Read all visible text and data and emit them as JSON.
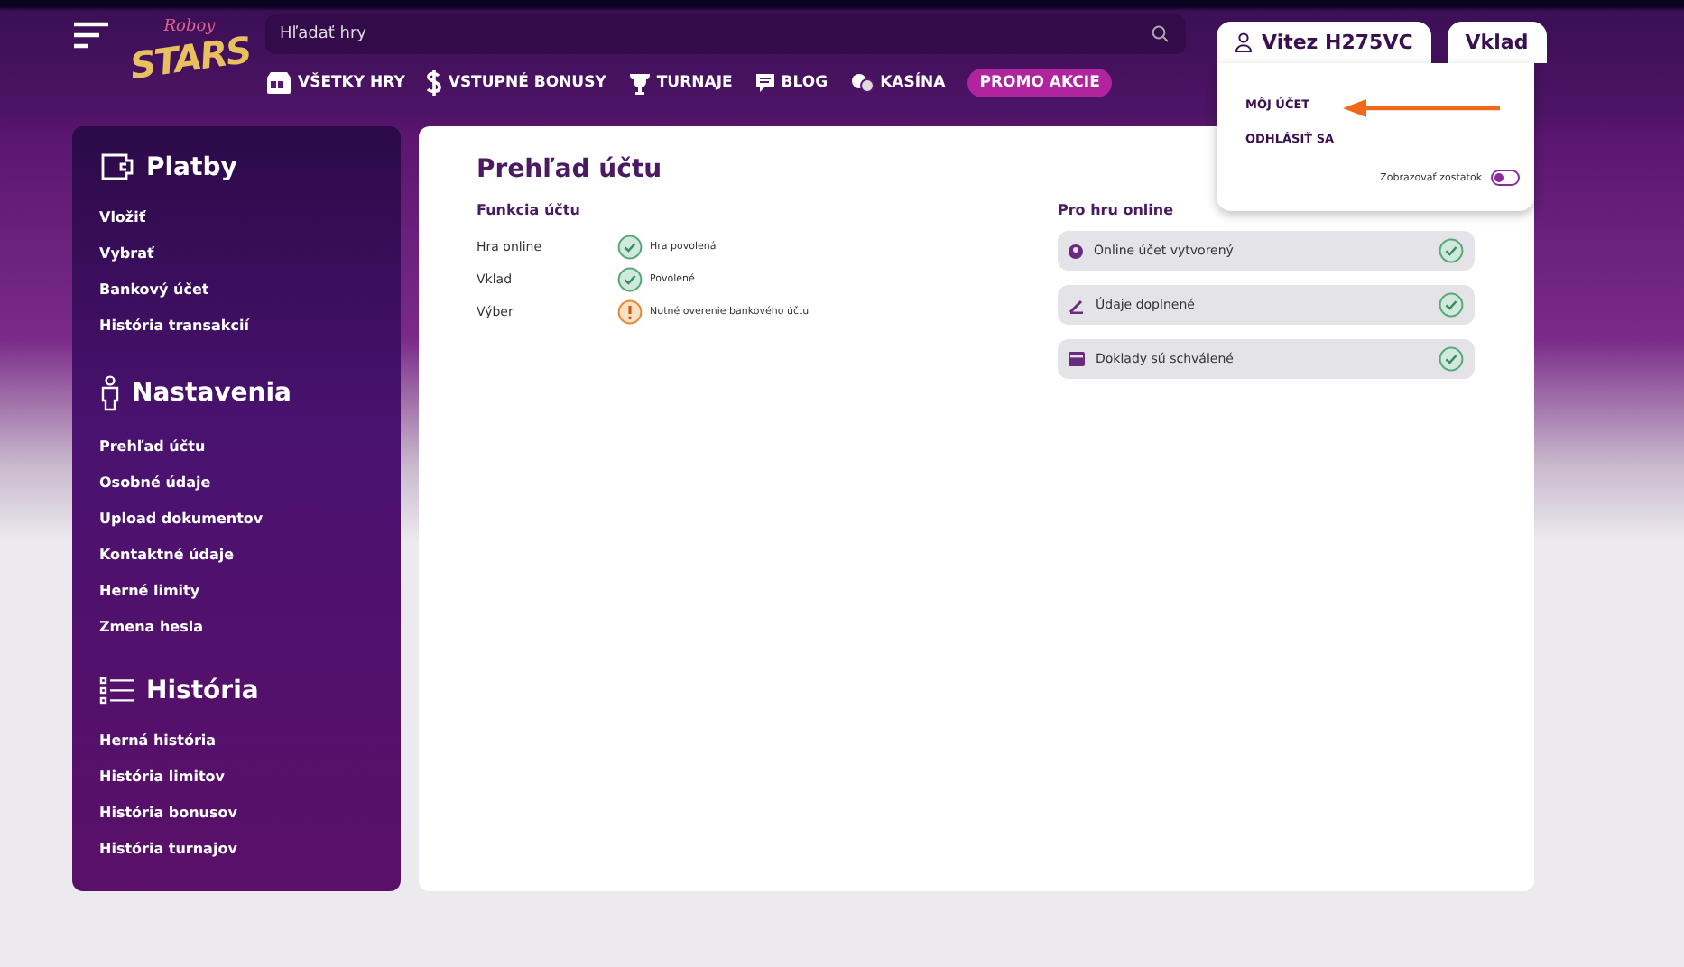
{
  "header": {
    "logo": {
      "top": "Roboy",
      "bottom": "STARS"
    },
    "search": {
      "placeholder": "Hľadať hry"
    },
    "nav": [
      {
        "label": "VŠETKY HRY",
        "highlighted": false
      },
      {
        "label": "VSTUPNÉ BONUSY",
        "highlighted": false
      },
      {
        "label": "TURNAJE",
        "highlighted": false
      },
      {
        "label": "BLOG",
        "highlighted": false
      },
      {
        "label": "KASÍNA",
        "highlighted": false
      },
      {
        "label": "PROMO AKCIE",
        "highlighted": true
      }
    ],
    "user_button": "Vitez H275VC",
    "deposit_button": "Vklad"
  },
  "user_menu": {
    "items": [
      "MÔJ ÚČET",
      "ODHLÁSIŤ SA"
    ],
    "balance_toggle": {
      "label": "Zobrazovať zostatok",
      "on": false
    }
  },
  "sidebar": {
    "sections": [
      {
        "title": "Platby",
        "items": [
          "Vložiť",
          "Vybrať",
          "Bankový účet",
          "História transakcií"
        ]
      },
      {
        "title": "Nastavenia",
        "items": [
          "Prehľad účtu",
          "Osobné údaje",
          "Upload dokumentov",
          "Kontaktné údaje",
          "Herné limity",
          "Zmena hesla"
        ]
      },
      {
        "title": "História",
        "items": [
          "Herná história",
          "História limitov",
          "História bonusov",
          "História turnajov"
        ]
      }
    ]
  },
  "account": {
    "title": "Prehľad účtu",
    "functions": {
      "title": "Funkcia účtu",
      "rows": [
        {
          "label": "Hra online",
          "status": "Hra povolená",
          "kind": "ok"
        },
        {
          "label": "Vklad",
          "status": "Povolené",
          "kind": "ok"
        },
        {
          "label": "Výber",
          "status": "Nutné overenie bankového účtu",
          "kind": "warning"
        }
      ]
    },
    "online": {
      "title": "Pro hru online",
      "items": [
        {
          "label": "Online účet vytvorený",
          "kind": "ok"
        },
        {
          "label": "Údaje doplnené",
          "kind": "ok"
        },
        {
          "label": "Doklady sú schválené",
          "kind": "ok"
        }
      ]
    }
  }
}
